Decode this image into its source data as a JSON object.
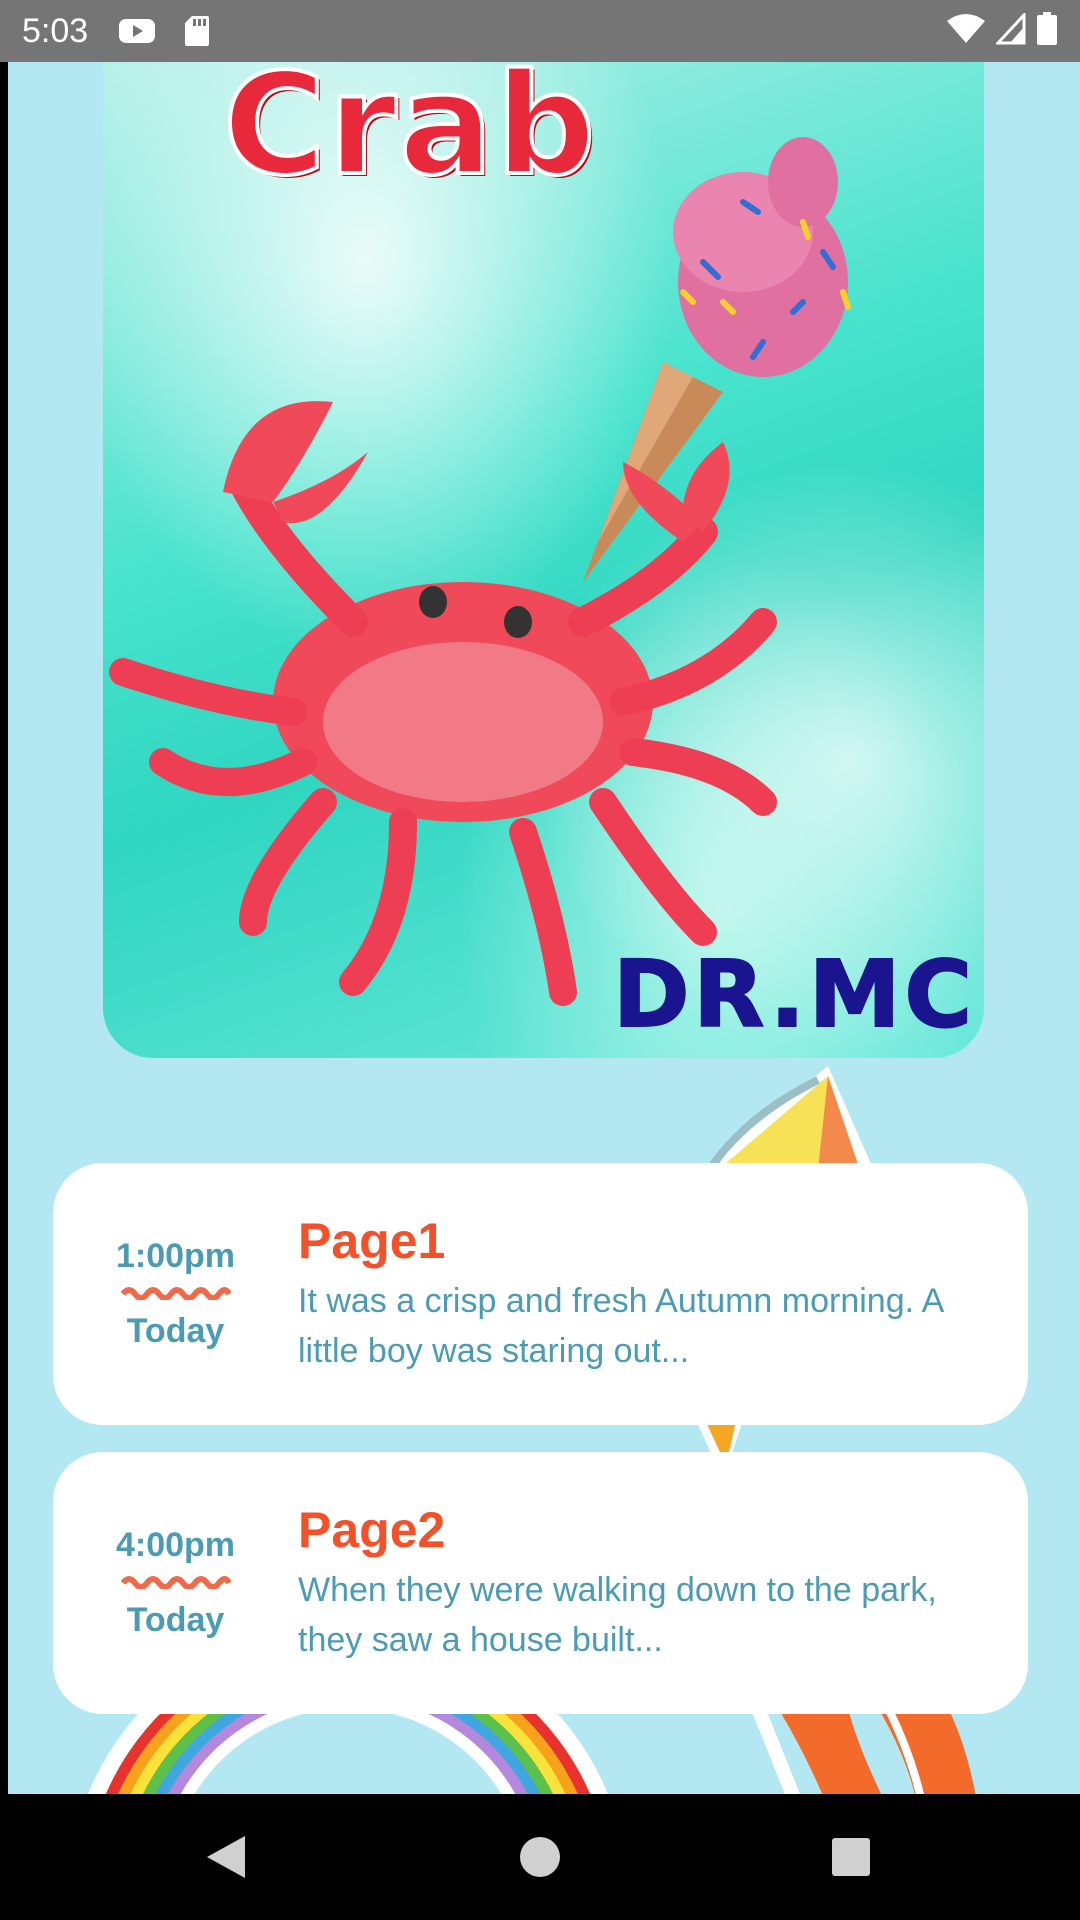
{
  "status_bar": {
    "time": "5:03",
    "icons": [
      "youtube-icon",
      "sd-card-icon",
      "wifi-icon",
      "signal-icon",
      "battery-icon"
    ]
  },
  "cover": {
    "title": "Crab",
    "author": "DR.MC"
  },
  "entries": [
    {
      "time": "1:00pm",
      "day": "Today",
      "title": "Page1",
      "snippet": "It was a crisp and fresh Autumn morning. A little boy was staring out..."
    },
    {
      "time": "4:00pm",
      "day": "Today",
      "title": "Page2",
      "snippet": "When they were walking down to the park, they saw a house built..."
    }
  ],
  "nav_bar": {
    "buttons": [
      "back-icon",
      "home-icon",
      "recents-icon"
    ]
  },
  "colors": {
    "background": "#b3e8f3",
    "accent_title": "#f2512a",
    "accent_text": "#4a9bb3",
    "status_bar": "#757575"
  }
}
